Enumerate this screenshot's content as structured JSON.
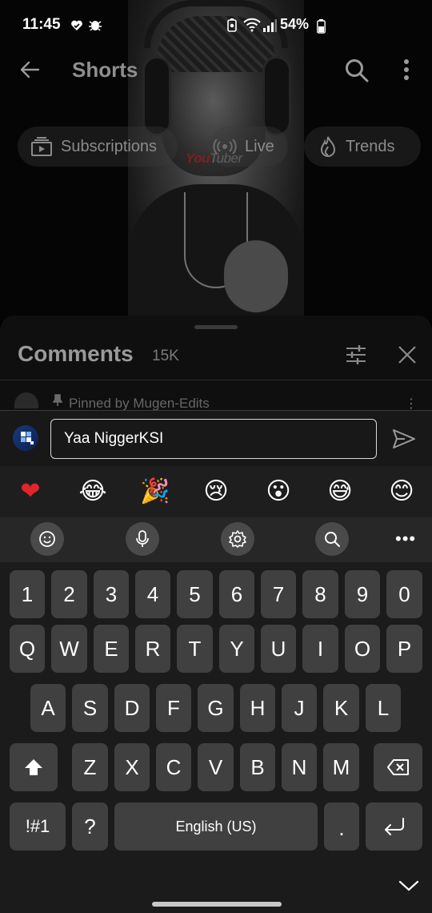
{
  "status_bar": {
    "time": "11:45",
    "battery": "54%"
  },
  "app_bar": {
    "title": "Shorts"
  },
  "chips": [
    {
      "label": "Subscriptions",
      "icon": "subscriptions-icon"
    },
    {
      "label": "Live",
      "icon": "live-icon"
    },
    {
      "label": "Trends",
      "icon": "trends-icon"
    }
  ],
  "video": {
    "watermark_red": "You",
    "watermark_gray": "Tuber"
  },
  "comments": {
    "title": "Comments",
    "count": "15K",
    "pinned_label": "Pinned by Mugen-Edits",
    "more_symbol": "⋮"
  },
  "comment_input": {
    "value": "Yaa NiggerKSI"
  },
  "emojis": [
    "❤",
    "😂",
    "🎉",
    "😢",
    "😮",
    "😅",
    "😊"
  ],
  "keyboard": {
    "row_numbers": [
      "1",
      "2",
      "3",
      "4",
      "5",
      "6",
      "7",
      "8",
      "9",
      "0"
    ],
    "row_top": [
      "Q",
      "W",
      "E",
      "R",
      "T",
      "Y",
      "U",
      "I",
      "O",
      "P"
    ],
    "row_mid": [
      "A",
      "S",
      "D",
      "F",
      "G",
      "H",
      "J",
      "K",
      "L"
    ],
    "row_bottom": [
      "Z",
      "X",
      "C",
      "V",
      "B",
      "N",
      "M"
    ],
    "symbols_key": "!#1",
    "question_key": "?",
    "space_label": "English (US)",
    "period_key": ".",
    "toolbar_more": "•••"
  }
}
